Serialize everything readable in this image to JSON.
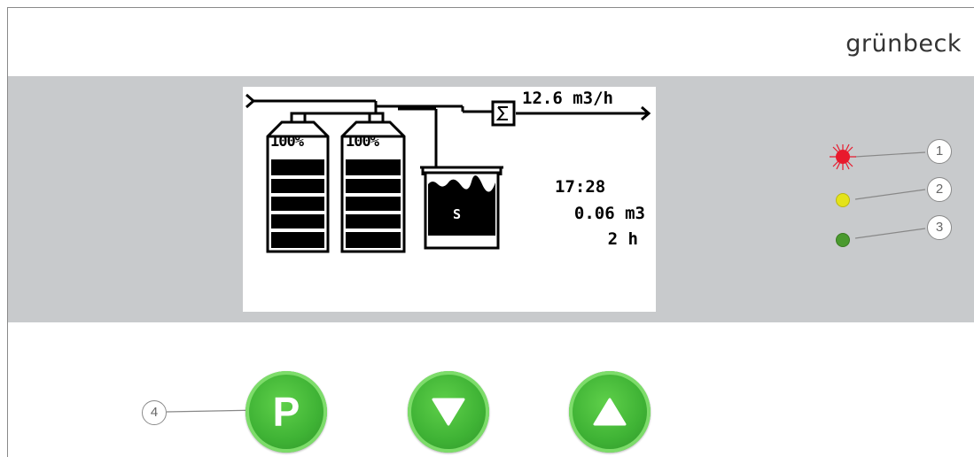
{
  "brand": {
    "name": "grünbeck"
  },
  "display": {
    "flow_rate": "12.6 m3/h",
    "tank1_fill": "100%",
    "tank2_fill": "100%",
    "brine_label": "S",
    "time": "17:28",
    "volume": "0.06 m3",
    "hours": "2 h"
  },
  "leds": [
    {
      "color": "#e8192c",
      "state": "flashing",
      "callout": "1"
    },
    {
      "color": "#e4e31a",
      "state": "on",
      "callout": "2"
    },
    {
      "color": "#4a9a2e",
      "state": "on",
      "callout": "3"
    }
  ],
  "buttons": {
    "program_label": "P",
    "program_callout": "4",
    "down_icon": "triangle-down-icon",
    "up_icon": "triangle-up-icon",
    "accent": "#3fb335"
  }
}
